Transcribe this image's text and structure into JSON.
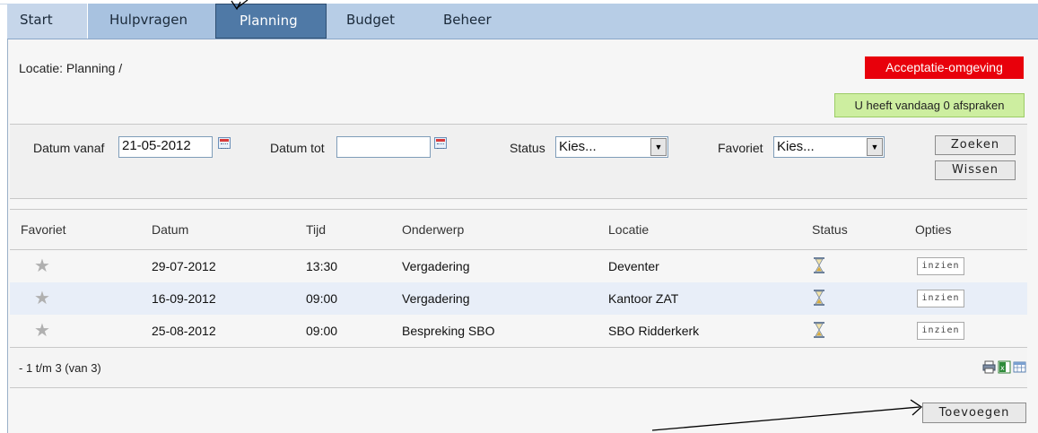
{
  "nav": {
    "tabs": [
      "Start",
      "Hulpvragen",
      "Planning",
      "Budget",
      "Beheer"
    ],
    "active": "Planning"
  },
  "breadcrumb": "Locatie: Planning /",
  "environment_badge": "Acceptatie-omgeving",
  "appointments_notice": "U heeft vandaag 0 afspraken",
  "filters": {
    "datum_vanaf_label": "Datum vanaf",
    "datum_vanaf_value": "21-05-2012",
    "datum_tot_label": "Datum tot",
    "datum_tot_value": "",
    "status_label": "Status",
    "status_value": "Kies...",
    "favoriet_label": "Favoriet",
    "favoriet_value": "Kies...",
    "search_button": "Zoeken",
    "clear_button": "Wissen"
  },
  "table": {
    "columns": [
      "Favoriet",
      "Datum",
      "Tijd",
      "Onderwerp",
      "Locatie",
      "Status",
      "Opties"
    ],
    "rows": [
      {
        "datum": "29-07-2012",
        "tijd": "13:30",
        "onderwerp": "Vergadering",
        "locatie": "Deventer",
        "status_icon": "hourglass-icon",
        "option": "inzien"
      },
      {
        "datum": "16-09-2012",
        "tijd": "09:00",
        "onderwerp": "Vergadering",
        "locatie": "Kantoor ZAT",
        "status_icon": "hourglass-icon",
        "option": "inzien"
      },
      {
        "datum": "25-08-2012",
        "tijd": "09:00",
        "onderwerp": "Bespreking SBO",
        "locatie": "SBO Ridderkerk",
        "status_icon": "hourglass-icon",
        "option": "inzien"
      }
    ],
    "pagination": "- 1 t/m 3 (van 3)",
    "export_icons": [
      "printer-icon",
      "excel-icon",
      "table-icon"
    ]
  },
  "add_button": "Toevoegen",
  "colors": {
    "nav_bg": "#b7cde6",
    "active_tab": "#4f79a6",
    "badge_red": "#e8000b",
    "notice_green": "#cdeea0",
    "row_highlight": "#e8eef8"
  }
}
